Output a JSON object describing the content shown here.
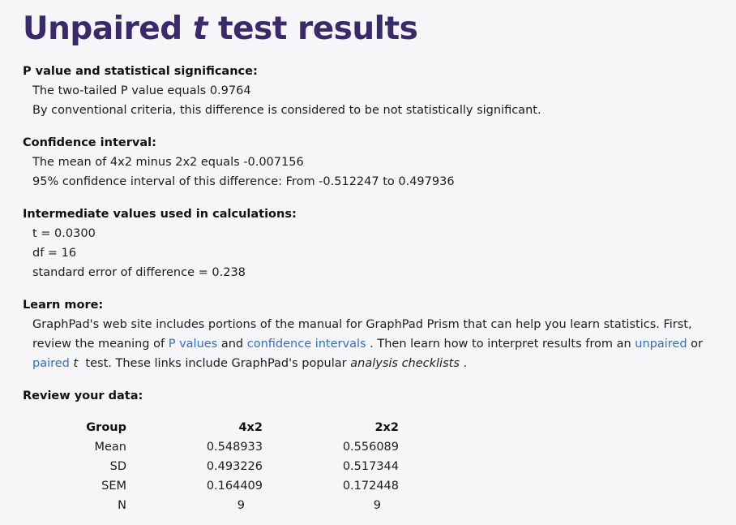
{
  "title": {
    "prefix": "Unpaired ",
    "var": "t",
    "suffix": " test results"
  },
  "pvalue": {
    "heading": "P value and statistical significance:",
    "line1": "The two-tailed P value equals 0.9764",
    "line2": "By conventional criteria, this difference is considered to be not statistically significant."
  },
  "ci": {
    "heading": "Confidence interval:",
    "line1": "The mean of 4x2 minus 2x2 equals -0.007156",
    "line2": "95% confidence interval of this difference: From -0.512247 to 0.497936"
  },
  "intermediate": {
    "heading": "Intermediate values used in calculations:",
    "t": "t = 0.0300",
    "df": "df = 16",
    "se": "standard error of difference = 0.238"
  },
  "learn": {
    "heading": "Learn more:",
    "p1": "GraphPad's web site includes portions of the manual for GraphPad Prism that can help you learn statistics. First, review the meaning of",
    "link_pvalues": "P values",
    "and": "and",
    "link_ci": "confidence intervals",
    "p2": ". Then learn how to interpret results from an",
    "link_unpaired": "unpaired",
    "or": "or",
    "link_paired": "paired",
    "tvar": "t",
    "p3": "test. These links include GraphPad's popular",
    "checklists": "analysis checklists",
    "end": "."
  },
  "review": {
    "heading": "Review your data:",
    "headers": [
      "Group",
      "4x2",
      "2x2"
    ],
    "rows": [
      [
        "Mean",
        "0.548933",
        "0.556089"
      ],
      [
        "SD",
        "0.493226",
        "0.517344"
      ],
      [
        "SEM",
        "0.164409",
        "0.172448"
      ],
      [
        "N",
        "9",
        "9"
      ]
    ]
  }
}
